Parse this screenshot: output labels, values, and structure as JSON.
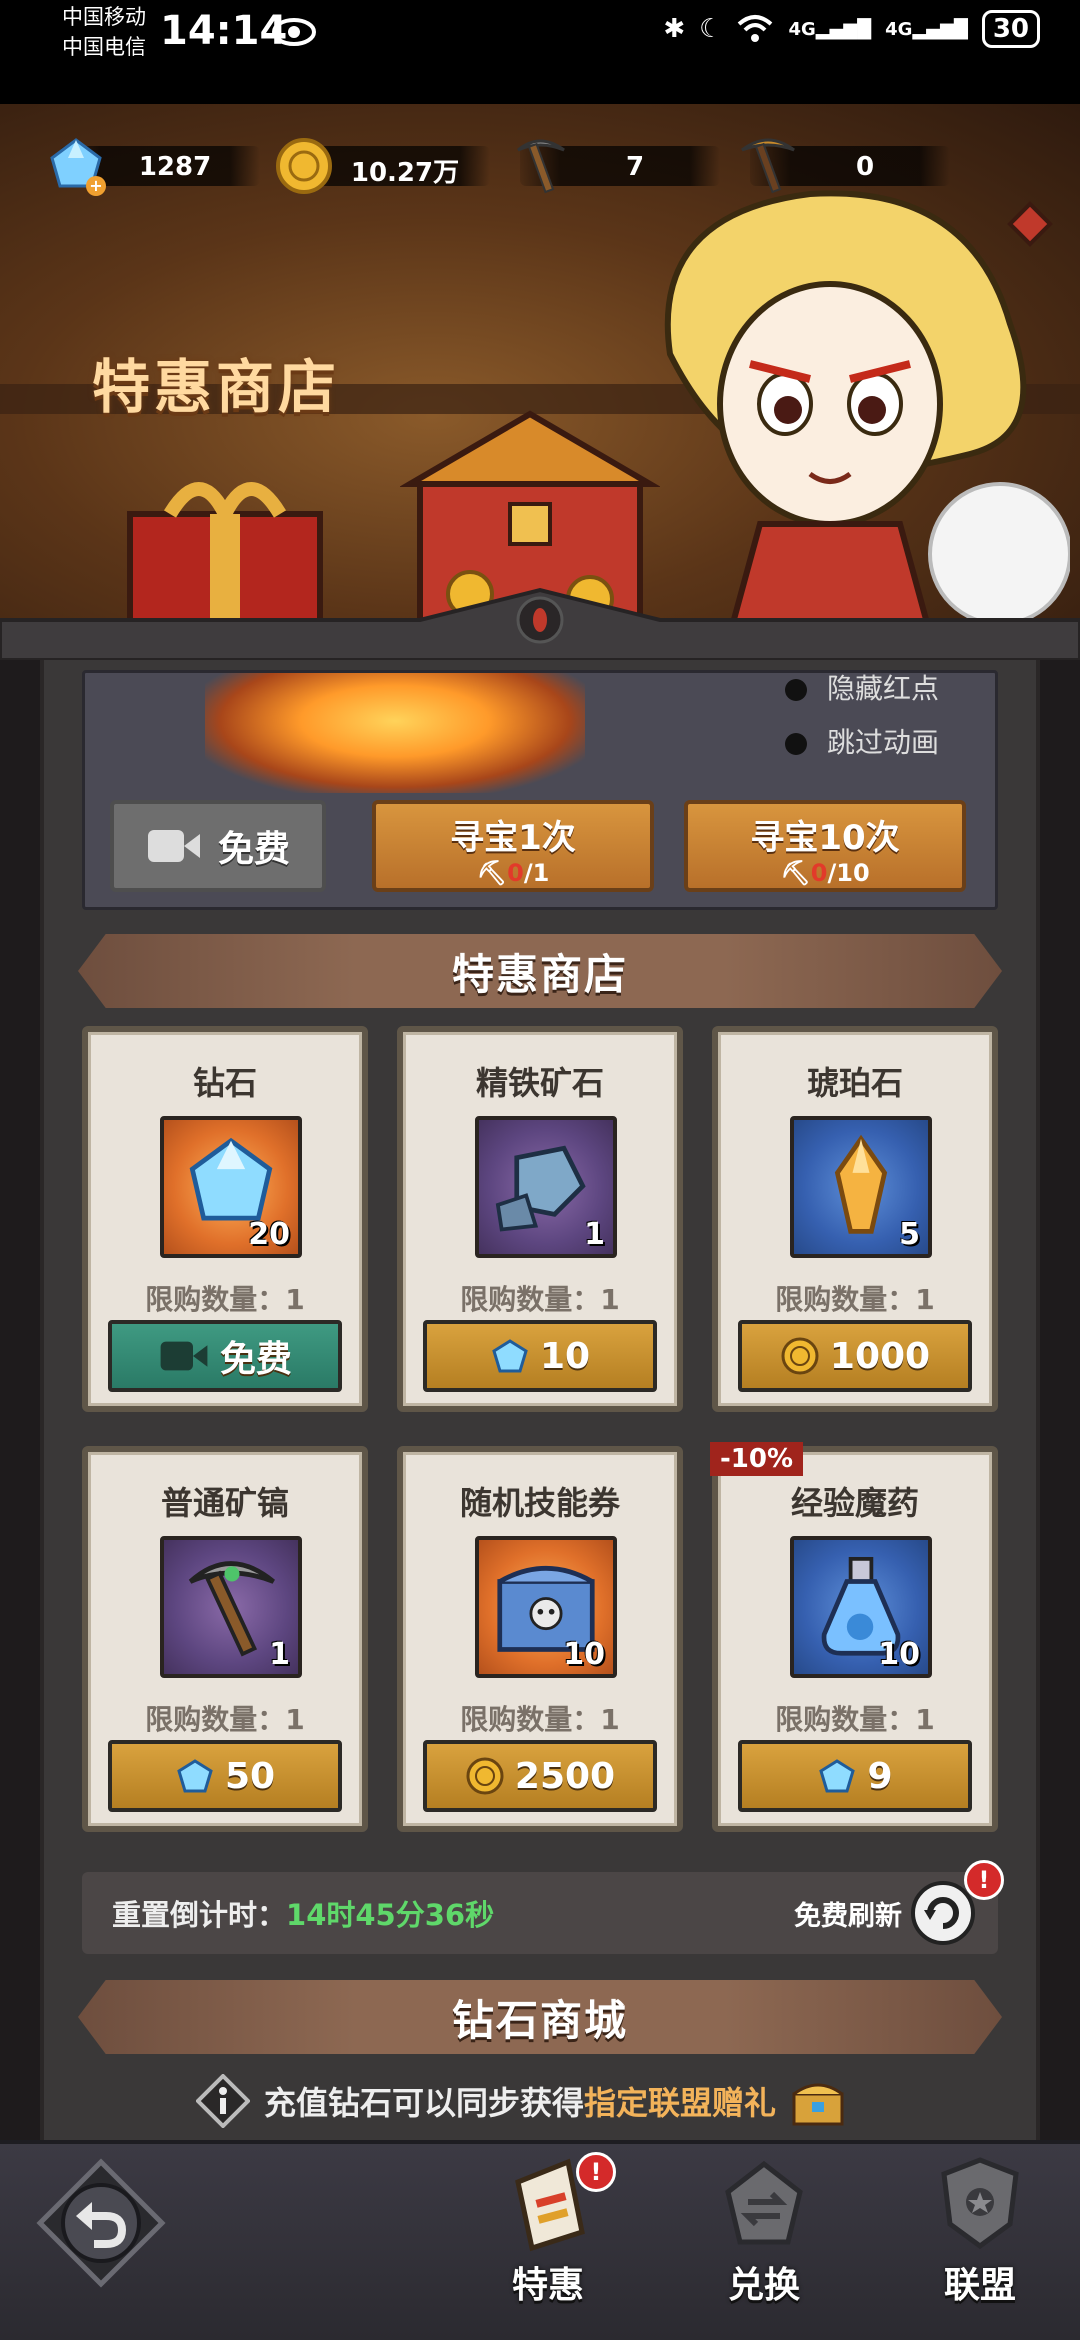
{
  "status_bar": {
    "carrier_1": "中国移动",
    "carrier_2": "中国电信",
    "time": "14:14",
    "network_1": "4G",
    "network_2": "4G",
    "battery": "30"
  },
  "resources": {
    "diamond": "1287",
    "gold": "10.27万",
    "pickaxe": "7",
    "special_pickaxe": "0"
  },
  "hero": {
    "title": "特惠商店"
  },
  "treasure_hunt": {
    "options": [
      "隐藏红点",
      "跳过动画"
    ],
    "free_label": "免费",
    "hunt_1": {
      "label": "寻宝1次",
      "used": "0",
      "total": "/1"
    },
    "hunt_10": {
      "label": "寻宝10次",
      "used": "0",
      "total": "/10"
    }
  },
  "shop": {
    "title": "特惠商店",
    "items": [
      {
        "name": "钻石",
        "qty": "20",
        "limit": "限购数量：1",
        "price": "免费",
        "currency": "video"
      },
      {
        "name": "精铁矿石",
        "qty": "1",
        "limit": "限购数量：1",
        "price": "10",
        "currency": "diamond"
      },
      {
        "name": "琥珀石",
        "qty": "5",
        "limit": "限购数量：1",
        "price": "1000",
        "currency": "gold"
      },
      {
        "name": "普通矿镐",
        "qty": "1",
        "limit": "限购数量：1",
        "price": "50",
        "currency": "diamond"
      },
      {
        "name": "随机技能券",
        "qty": "10",
        "limit": "限购数量：1",
        "price": "2500",
        "currency": "gold"
      },
      {
        "name": "经验魔药",
        "qty": "10",
        "limit": "限购数量：1",
        "price": "9",
        "currency": "diamond",
        "discount": "-10%"
      }
    ],
    "reset_label": "重置倒计时：",
    "reset_time": "14时45分36秒",
    "refresh_label": "免费刷新",
    "refresh_badge": "!"
  },
  "diamond_mall": {
    "title": "钻石商城",
    "info_prefix": "充值钻石可以同步获得",
    "info_highlight": "指定联盟赠礼"
  },
  "bottom_nav": {
    "tabs": [
      {
        "label": "特惠",
        "badge": "!"
      },
      {
        "label": "兑换"
      },
      {
        "label": "联盟"
      }
    ]
  },
  "colors": {
    "accent_gold": "#d9a23e",
    "timer_green": "#5fd86a",
    "highlight_orange": "#f3b35a",
    "alert_red": "#d42a2a"
  }
}
